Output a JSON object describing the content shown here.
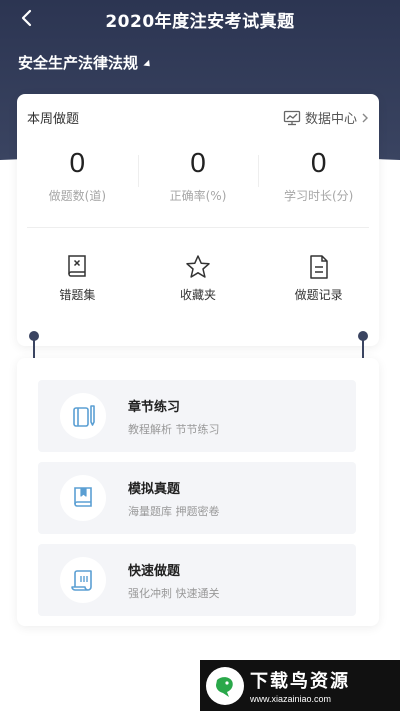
{
  "header": {
    "title": "2020年度注安考试真题",
    "subject": "安全生产法律法规"
  },
  "weekly": {
    "title": "本周做题",
    "data_center": "数据中心",
    "stats": [
      {
        "value": "0",
        "label": "做题数(道)"
      },
      {
        "value": "0",
        "label": "正确率(%)"
      },
      {
        "value": "0",
        "label": "学习时长(分)"
      }
    ],
    "tools": [
      {
        "label": "错题集",
        "icon": "wrong-book-icon"
      },
      {
        "label": "收藏夹",
        "icon": "star-icon"
      },
      {
        "label": "做题记录",
        "icon": "record-doc-icon"
      }
    ]
  },
  "practice": [
    {
      "title": "章节练习",
      "desc": "教程解析 节节练习",
      "icon": "pen-notebook-icon"
    },
    {
      "title": "模拟真题",
      "desc": "海量题库 押题密卷",
      "icon": "bookmark-book-icon"
    },
    {
      "title": "快速做题",
      "desc": "强化冲刺 快速通关",
      "icon": "scroll-icon"
    }
  ],
  "watermark": {
    "title": "下载鸟资源",
    "url": "www.xiazainiao.com"
  },
  "colors": {
    "header": "#2c3552",
    "accent": "#5b9fd3",
    "entry_bg": "#f4f5f8"
  }
}
